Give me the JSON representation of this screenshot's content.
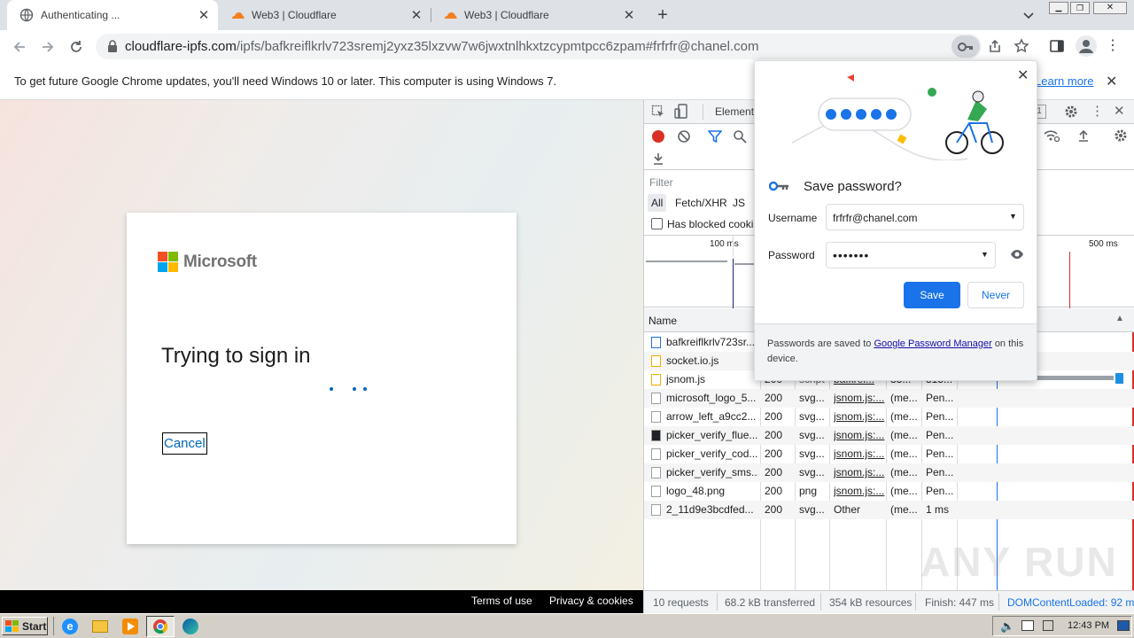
{
  "tabs": [
    {
      "title": "Authenticating ...",
      "active": true
    },
    {
      "title": "Web3 | Cloudflare",
      "active": false
    },
    {
      "title": "Web3 | Cloudflare",
      "active": false
    }
  ],
  "toolbar": {
    "url_host": "cloudflare-ipfs.com",
    "url_path": "/ipfs/bafkreiflkrlv723sremj2yxz35lxzvw7w6jwxtnlhkxtzcypmtpcc6zpam#frfrfr@chanel.com"
  },
  "infobar": {
    "message": "To get future Google Chrome updates, you'll need Windows 10 or later. This computer is using Windows 7.",
    "learn_more": "Learn more"
  },
  "signin": {
    "brand": "Microsoft",
    "heading": "Trying to sign in",
    "cancel": "Cancel"
  },
  "page_footer": {
    "terms": "Terms of use",
    "privacy": "Privacy & cookies"
  },
  "devtools": {
    "elements_tab": "Element",
    "badge": "1",
    "filter_placeholder": "Filter",
    "filter_types": [
      "All",
      "Fetch/XHR",
      "JS"
    ],
    "has_blocked": "Has blocked cooki",
    "timeline_labels": [
      "100 ms",
      "500 ms"
    ],
    "col_name": "Name",
    "rows": [
      {
        "name": "bafkreiflkrlv723sr...",
        "status": "",
        "type": "",
        "initiator": "",
        "size": "",
        "time": "",
        "icon": "doc"
      },
      {
        "name": "socket.io.js",
        "status": "",
        "type": "",
        "initiator": "",
        "size": "",
        "time": "",
        "icon": "js"
      },
      {
        "name": "jsnom.js",
        "status": "200",
        "type": "script",
        "initiator": "bafkrei...",
        "size": "33...",
        "time": "315...",
        "icon": "js"
      },
      {
        "name": "microsoft_logo_5...",
        "status": "200",
        "type": "svg...",
        "initiator": "jsnom.js:...",
        "size": "(me...",
        "time": "Pen...",
        "icon": "img"
      },
      {
        "name": "arrow_left_a9cc2...",
        "status": "200",
        "type": "svg...",
        "initiator": "jsnom.js:...",
        "size": "(me...",
        "time": "Pen...",
        "icon": "img"
      },
      {
        "name": "picker_verify_flue...",
        "status": "200",
        "type": "svg...",
        "initiator": "jsnom.js:...",
        "size": "(me...",
        "time": "Pen...",
        "icon": "lock"
      },
      {
        "name": "picker_verify_cod...",
        "status": "200",
        "type": "svg...",
        "initiator": "jsnom.js:...",
        "size": "(me...",
        "time": "Pen...",
        "icon": "img"
      },
      {
        "name": "picker_verify_sms...",
        "status": "200",
        "type": "svg...",
        "initiator": "jsnom.js:...",
        "size": "(me...",
        "time": "Pen...",
        "icon": "img"
      },
      {
        "name": "logo_48.png",
        "status": "200",
        "type": "png",
        "initiator": "jsnom.js:...",
        "size": "(me...",
        "time": "Pen...",
        "icon": "png"
      },
      {
        "name": "2_11d9e3bcdfed...",
        "status": "200",
        "type": "svg...",
        "initiator": "Other",
        "size": "(me...",
        "time": "1 ms",
        "icon": "img"
      }
    ],
    "status_bar": [
      "10 requests",
      "68.2 kB transferred",
      "354 kB resources",
      "Finish: 447 ms",
      "DOMContentLoaded: 92 m"
    ]
  },
  "popup": {
    "title": "Save password?",
    "username_label": "Username",
    "username_value": "frfrfr@chanel.com",
    "password_label": "Password",
    "password_value": "•••••••",
    "save": "Save",
    "never": "Never",
    "footer_text": "Passwords are saved to",
    "footer_link": "Google Password Manager",
    "footer_tail": "on this",
    "footer_tail2": "device."
  },
  "taskbar": {
    "start": "Start",
    "clock": "12:43 PM"
  },
  "watermark": "ANY RUN"
}
